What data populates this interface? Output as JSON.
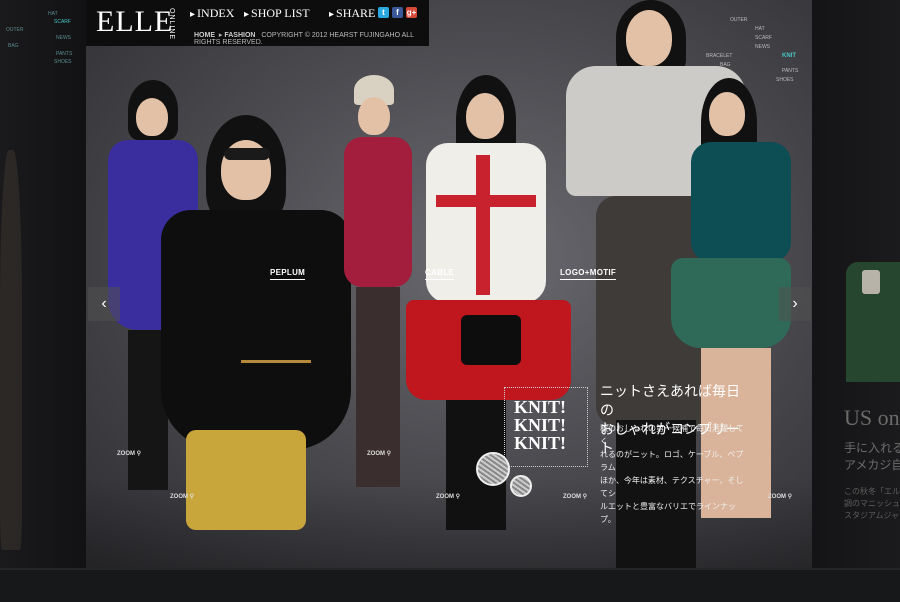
{
  "header": {
    "logo": "ELLE",
    "logo_sub": "ONLINE",
    "nav": [
      {
        "label": "INDEX"
      },
      {
        "label": "SHOP LIST"
      },
      {
        "label": "SHARE"
      }
    ],
    "social": [
      "t",
      "f",
      "g+"
    ],
    "breadcrumb": {
      "home": "HOME",
      "section": "FASHION",
      "copyright": "COPYRIGHT © 2012 HEARST FUJINGAHO ALL RIGHTS RESERVED."
    }
  },
  "categories": [
    "PEPLUM",
    "CABLE",
    "LOGO+MOTIF"
  ],
  "zoom_label": "ZOOM",
  "feature": {
    "title_lines": [
      "KNIT!",
      "KNIT!",
      "KNIT!"
    ],
    "headline_lines": [
      "ニットさえあれば毎日の",
      "おしゃれがコンプリート"
    ],
    "body_lines": [
      "秋のおしゃれの第一候補で毎日活躍してく",
      "れるのがニット。ロゴ、ケーブル、ペプラム",
      "ほか、今年は素材、テクスチャー、そしてシ",
      "ルエットと豊富なバリエでラインナップ。"
    ]
  },
  "mini_map_right": {
    "items": [
      "OUTER",
      "HAT",
      "SCARF",
      "NEWS",
      "BRACELET",
      "BAG",
      "KNIT",
      "PANTS",
      "SHOES"
    ],
    "active": "KNIT"
  },
  "mini_map_left": [
    "HAT",
    "SCARF",
    "OUTER",
    "NEWS",
    "BAG",
    "PANTS",
    "SHOES"
  ],
  "arrows": {
    "prev": "‹",
    "next": "›"
  },
  "side_right": {
    "title": "US on",
    "jp_lines": [
      "手に入れる",
      "アメカジ自"
    ],
    "small_lines": [
      "この秋冬「エル",
      "調のマニッシュ",
      "スタジアムジャ"
    ]
  },
  "colors": {
    "accent_knit": "#4ac6c6",
    "twitter": "#2aa9e0",
    "facebook": "#3b5998",
    "google": "#d64937"
  }
}
